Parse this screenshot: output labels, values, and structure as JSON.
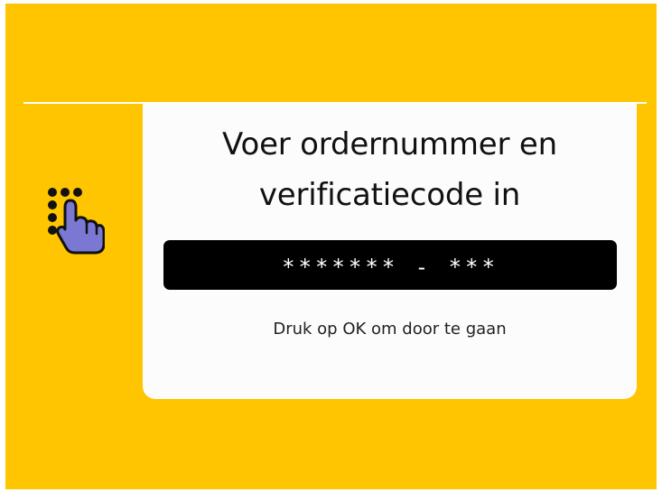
{
  "screen": {
    "background_color": "#ffc500",
    "icon": "touch-keypad-icon",
    "title": "Voer ordernummer en\nverificatiecode in",
    "code_display": "******* - ***",
    "hint": "Druk op OK om door te gaan"
  }
}
